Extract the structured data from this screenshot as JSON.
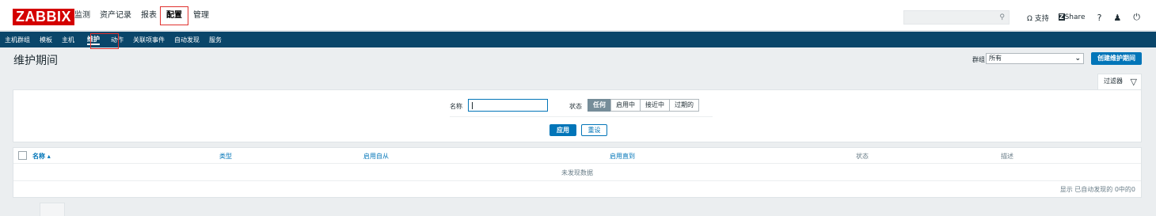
{
  "brand": {
    "logo": "ZABBIX",
    "logo_color": "#d40000"
  },
  "main_nav": {
    "items": [
      {
        "label": "监测"
      },
      {
        "label": "资产记录"
      },
      {
        "label": "报表"
      },
      {
        "label": "配置",
        "selected": true
      },
      {
        "label": "管理"
      }
    ]
  },
  "top_right": {
    "search_icon": "search-icon",
    "support_label": "支持",
    "share_label": "Share",
    "help_label": "?",
    "icons": [
      "headset-icon",
      "zabbix-share-icon",
      "help-icon",
      "user-icon",
      "power-icon"
    ]
  },
  "sub_nav": {
    "items": [
      {
        "label": "主机群组"
      },
      {
        "label": "模板"
      },
      {
        "label": "主机"
      },
      {
        "label": "维护",
        "selected": true
      },
      {
        "label": "动作"
      },
      {
        "label": "关联项事件"
      },
      {
        "label": "自动发现"
      },
      {
        "label": "服务"
      }
    ]
  },
  "header": {
    "title": "维护期间",
    "group_label": "群组",
    "group_value": "所有",
    "create_button": "创建维护期间"
  },
  "filter": {
    "tab_label": "过滤器",
    "name_label": "名称",
    "name_value": "",
    "status_label": "状态",
    "status_options": [
      "任何",
      "启用中",
      "接近中",
      "过期的"
    ],
    "status_selected": "任何",
    "apply_label": "应用",
    "reset_label": "重设"
  },
  "table": {
    "columns": [
      "名称 ▴",
      "类型",
      "启用自从",
      "启用直到",
      "状态",
      "描述"
    ],
    "empty_text": "未发现数据",
    "count_text": "显示 已自动发现的 0中的0"
  },
  "colors": {
    "accent": "#0275b8",
    "subnav_bg": "#0a466a",
    "highlight": "#e0312e",
    "page_bg": "#ebeef0"
  }
}
